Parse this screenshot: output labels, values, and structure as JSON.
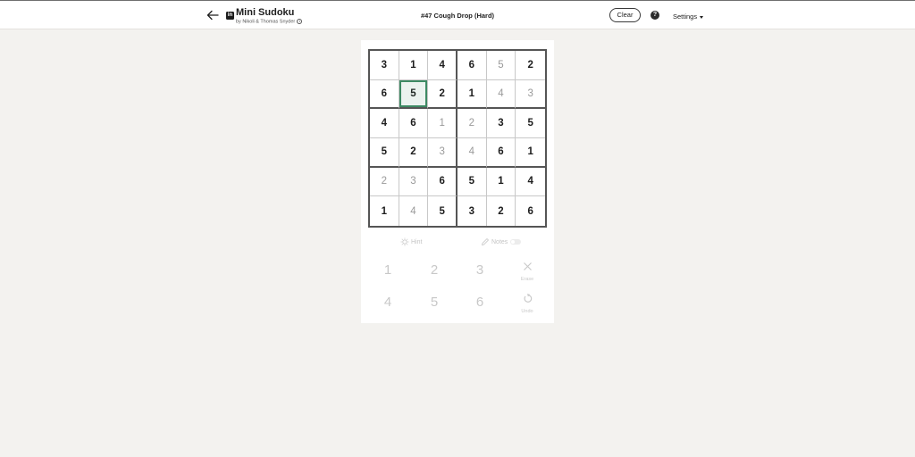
{
  "header": {
    "app_title": "Mini Sudoku",
    "byline": "by Nikoli & Thomas Snyder",
    "puzzle_title": "#47 Cough Drop (Hard)",
    "clear_label": "Clear",
    "help_symbol": "?",
    "settings_label": "Settings",
    "logo_text": "in"
  },
  "board": {
    "rows": [
      [
        {
          "v": "3",
          "user": false
        },
        {
          "v": "1",
          "user": false
        },
        {
          "v": "4",
          "user": false
        },
        {
          "v": "6",
          "user": false
        },
        {
          "v": "5",
          "user": true
        },
        {
          "v": "2",
          "user": false
        }
      ],
      [
        {
          "v": "6",
          "user": false
        },
        {
          "v": "5",
          "user": false,
          "selected": true
        },
        {
          "v": "2",
          "user": false
        },
        {
          "v": "1",
          "user": false
        },
        {
          "v": "4",
          "user": true
        },
        {
          "v": "3",
          "user": true
        }
      ],
      [
        {
          "v": "4",
          "user": false
        },
        {
          "v": "6",
          "user": false
        },
        {
          "v": "1",
          "user": true
        },
        {
          "v": "2",
          "user": true
        },
        {
          "v": "3",
          "user": false
        },
        {
          "v": "5",
          "user": false
        }
      ],
      [
        {
          "v": "5",
          "user": false
        },
        {
          "v": "2",
          "user": false
        },
        {
          "v": "3",
          "user": true
        },
        {
          "v": "4",
          "user": true
        },
        {
          "v": "6",
          "user": false
        },
        {
          "v": "1",
          "user": false
        }
      ],
      [
        {
          "v": "2",
          "user": true
        },
        {
          "v": "3",
          "user": true
        },
        {
          "v": "6",
          "user": false
        },
        {
          "v": "5",
          "user": false
        },
        {
          "v": "1",
          "user": false
        },
        {
          "v": "4",
          "user": false
        }
      ],
      [
        {
          "v": "1",
          "user": false
        },
        {
          "v": "4",
          "user": true
        },
        {
          "v": "5",
          "user": false
        },
        {
          "v": "3",
          "user": false
        },
        {
          "v": "2",
          "user": false
        },
        {
          "v": "6",
          "user": false
        }
      ]
    ]
  },
  "tools": {
    "hint_label": "Hint",
    "notes_label": "Notes"
  },
  "numpad": {
    "numbers": [
      "1",
      "2",
      "3",
      "4",
      "5",
      "6"
    ],
    "erase_label": "Erase",
    "undo_label": "Undo"
  },
  "colors": {
    "selected_border": "#3d8a63",
    "background": "#f3f2ef",
    "given_digit": "#1d1d1d",
    "entered_digit": "#9a9a9a"
  }
}
